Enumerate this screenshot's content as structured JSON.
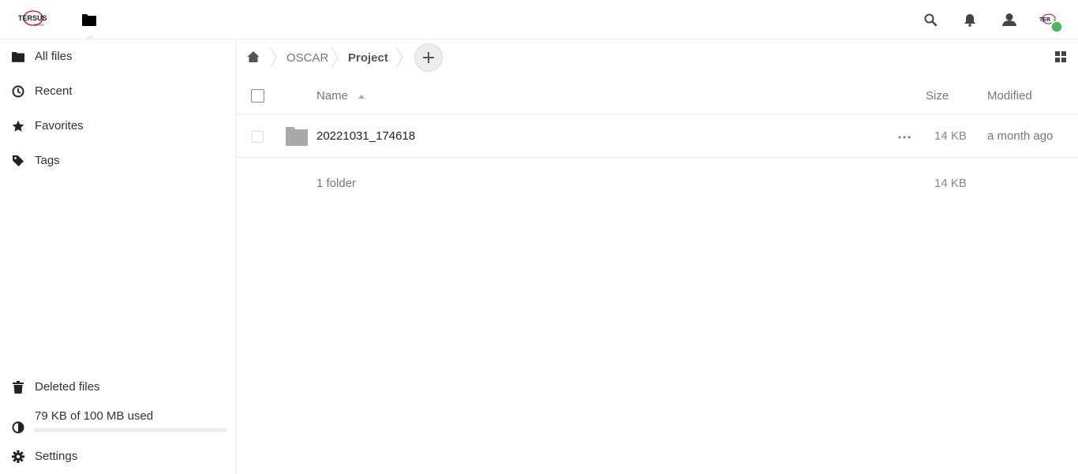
{
  "header": {
    "logo_text": "TERSUS GNSS",
    "avatar_text": "TER",
    "status_color": "#46ba61",
    "icons": [
      "files-app-icon",
      "search-icon",
      "notifications-icon",
      "contacts-icon",
      "avatar"
    ]
  },
  "sidebar": {
    "items": [
      {
        "label": "All files",
        "icon": "folder-icon"
      },
      {
        "label": "Recent",
        "icon": "clock-icon"
      },
      {
        "label": "Favorites",
        "icon": "star-icon"
      },
      {
        "label": "Tags",
        "icon": "tag-icon"
      }
    ],
    "deleted_label": "Deleted files",
    "quota_label": "79 KB of 100 MB used",
    "quota_fraction": 0.0008,
    "settings_label": "Settings"
  },
  "breadcrumb": {
    "items": [
      "OSCAR",
      "Project"
    ]
  },
  "table": {
    "headers": {
      "name": "Name",
      "size": "Size",
      "modified": "Modified"
    },
    "rows": [
      {
        "name": "20221031_174618",
        "size": "14 KB",
        "modified": "a month ago"
      }
    ],
    "summary": {
      "name": "1 folder",
      "size": "14 KB"
    }
  }
}
